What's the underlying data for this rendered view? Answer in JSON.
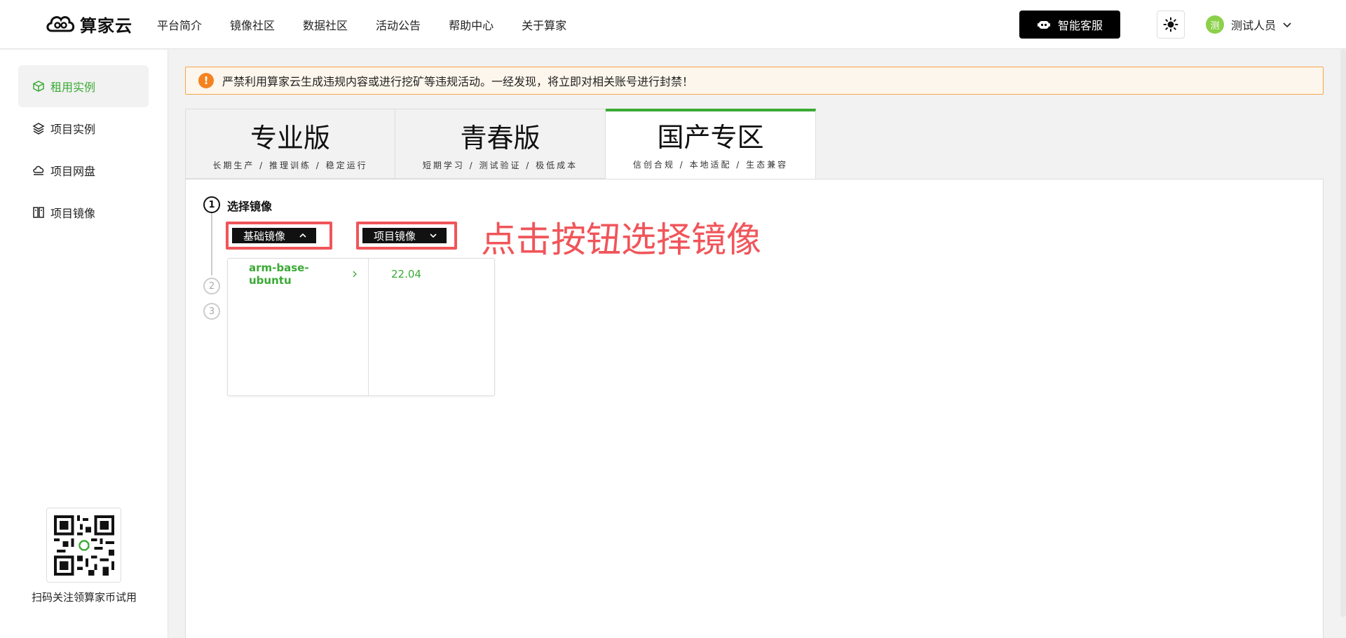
{
  "header": {
    "logo_text": "算家云",
    "nav": [
      "平台简介",
      "镜像社区",
      "数据社区",
      "活动公告",
      "帮助中心",
      "关于算家"
    ],
    "service_label": "智能客服",
    "user": {
      "avatar_char": "测",
      "name": "测试人员"
    }
  },
  "sidebar": {
    "items": [
      {
        "label": "租用实例",
        "icon": "box-icon",
        "active": true
      },
      {
        "label": "项目实例",
        "icon": "layers-icon",
        "active": false
      },
      {
        "label": "项目网盘",
        "icon": "cloud-disk-icon",
        "active": false
      },
      {
        "label": "项目镜像",
        "icon": "image-icon",
        "active": false
      }
    ],
    "qr_caption": "扫码关注领算家币试用"
  },
  "notice": {
    "icon": "!",
    "text": "严禁利用算家云生成违规内容或进行挖矿等违规活动。一经发现，将立即对相关账号进行封禁！"
  },
  "tabs": [
    {
      "title": "专业版",
      "subtitle": "长期生产 / 推理训练 / 稳定运行"
    },
    {
      "title": "青春版",
      "subtitle": "短期学习 / 测试验证 / 极低成本"
    },
    {
      "title": "国产专区",
      "subtitle": "信创合规 / 本地适配 / 生态兼容",
      "active": true
    }
  ],
  "steps": {
    "s1": "1",
    "s2": "2",
    "s3": "3",
    "step1_label": "选择镜像"
  },
  "buttons": {
    "base_image": "基础镜像",
    "project_image": "项目镜像"
  },
  "hint": "点击按钮选择镜像",
  "menu": {
    "images": [
      "arm-base-ubuntu"
    ],
    "versions": [
      "22.04"
    ]
  },
  "colors": {
    "accent": "#3aaa35",
    "highlight": "#f0555a",
    "warning": "#f58220"
  }
}
